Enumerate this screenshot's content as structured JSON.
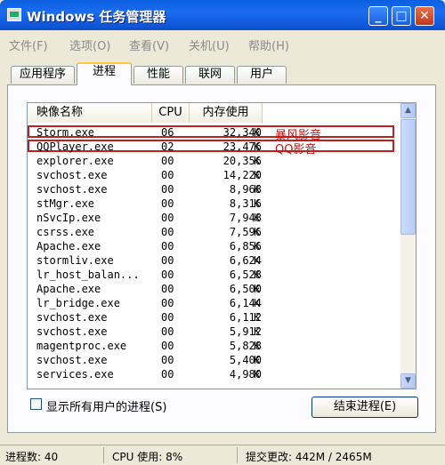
{
  "window": {
    "title": "Windows 任务管理器"
  },
  "menu": [
    "文件(F)",
    "选项(O)",
    "查看(V)",
    "关机(U)",
    "帮助(H)"
  ],
  "tabs": [
    "应用程序",
    "进程",
    "性能",
    "联网",
    "用户"
  ],
  "active_tab": "进程",
  "columns": {
    "name": "映像名称",
    "cpu": "CPU",
    "mem": "内存使用"
  },
  "processes": [
    {
      "name": "Storm.exe",
      "cpu": "06",
      "mem": "32,340",
      "unit": "K"
    },
    {
      "name": "QQPlayer.exe",
      "cpu": "02",
      "mem": "23,476",
      "unit": "K"
    },
    {
      "name": "explorer.exe",
      "cpu": "00",
      "mem": "20,356",
      "unit": "K"
    },
    {
      "name": "svchost.exe",
      "cpu": "00",
      "mem": "14,220",
      "unit": "K"
    },
    {
      "name": "svchost.exe",
      "cpu": "00",
      "mem": "8,968",
      "unit": "K"
    },
    {
      "name": "stMgr.exe",
      "cpu": "00",
      "mem": "8,316",
      "unit": "K"
    },
    {
      "name": "nSvcIp.exe",
      "cpu": "00",
      "mem": "7,948",
      "unit": "K"
    },
    {
      "name": "csrss.exe",
      "cpu": "00",
      "mem": "7,596",
      "unit": "K"
    },
    {
      "name": "Apache.exe",
      "cpu": "00",
      "mem": "6,856",
      "unit": "K"
    },
    {
      "name": "stormliv.exe",
      "cpu": "00",
      "mem": "6,624",
      "unit": "K"
    },
    {
      "name": "lr_host_balan...",
      "cpu": "00",
      "mem": "6,528",
      "unit": "K"
    },
    {
      "name": "Apache.exe",
      "cpu": "00",
      "mem": "6,500",
      "unit": "K"
    },
    {
      "name": "lr_bridge.exe",
      "cpu": "00",
      "mem": "6,144",
      "unit": "K"
    },
    {
      "name": "svchost.exe",
      "cpu": "00",
      "mem": "6,112",
      "unit": "K"
    },
    {
      "name": "svchost.exe",
      "cpu": "00",
      "mem": "5,912",
      "unit": "K"
    },
    {
      "name": "magentproc.exe",
      "cpu": "00",
      "mem": "5,828",
      "unit": "K"
    },
    {
      "name": "svchost.exe",
      "cpu": "00",
      "mem": "5,400",
      "unit": "K"
    },
    {
      "name": "services.exe",
      "cpu": "00",
      "mem": "4,980",
      "unit": "K"
    }
  ],
  "annotations": [
    "暴风影音",
    "QQ影音"
  ],
  "show_all_users_label": "显示所有用户的进程(S)",
  "end_process_label": "结束进程(E)",
  "status": {
    "processes": "进程数: 40",
    "cpu": "CPU 使用: 8%",
    "commit": "提交更改: 442M / 2465M"
  },
  "colors": {
    "titlebar": "#0a5fdf",
    "annotation": "#d01010",
    "background": "#ece9d8"
  }
}
